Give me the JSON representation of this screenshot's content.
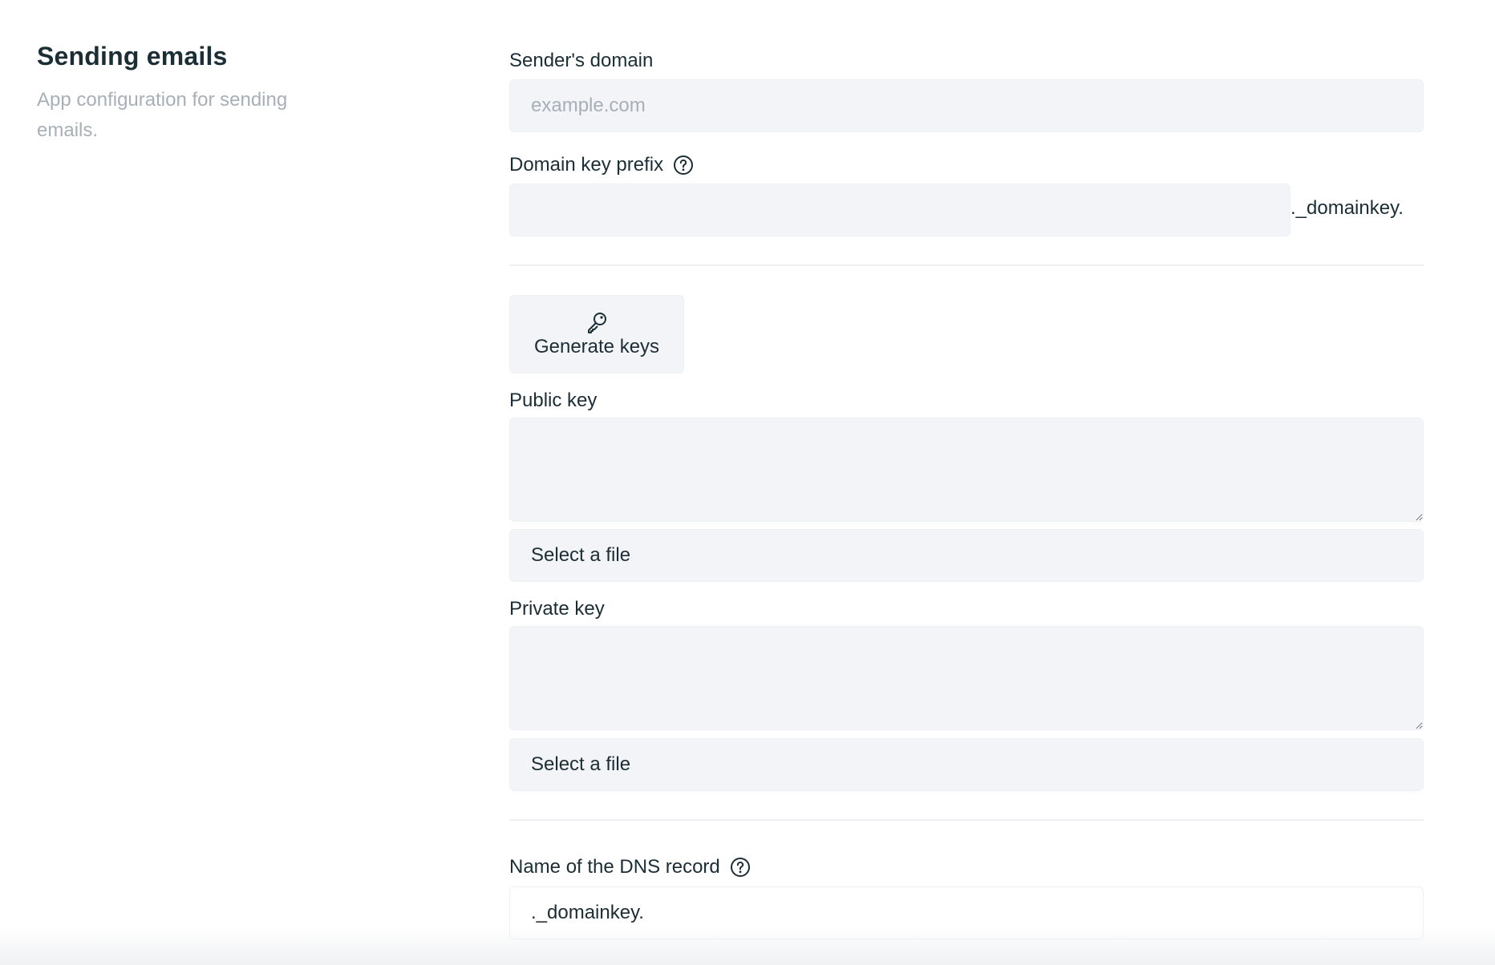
{
  "section": {
    "title": "Sending emails",
    "description": "App configuration for sending emails."
  },
  "fields": {
    "senders_domain": {
      "label": "Sender's domain",
      "placeholder": "example.com",
      "value": ""
    },
    "domain_key_prefix": {
      "label": "Domain key prefix",
      "value": "",
      "suffix": "._domainkey.",
      "help_icon": "question-circle-icon"
    },
    "generate_keys": {
      "label": "Generate keys",
      "icon": "key-icon"
    },
    "public_key": {
      "label": "Public key",
      "value": "",
      "file_button_label": "Select a file"
    },
    "private_key": {
      "label": "Private key",
      "value": "",
      "file_button_label": "Select a file"
    },
    "dns_record_name": {
      "label": "Name of the DNS record",
      "value": "._domainkey.",
      "help_icon": "question-circle-icon"
    }
  },
  "colors": {
    "text": "#1b2d35",
    "muted": "#a7afb8",
    "field_bg": "#f3f4f7",
    "divider": "#eef0f3"
  }
}
